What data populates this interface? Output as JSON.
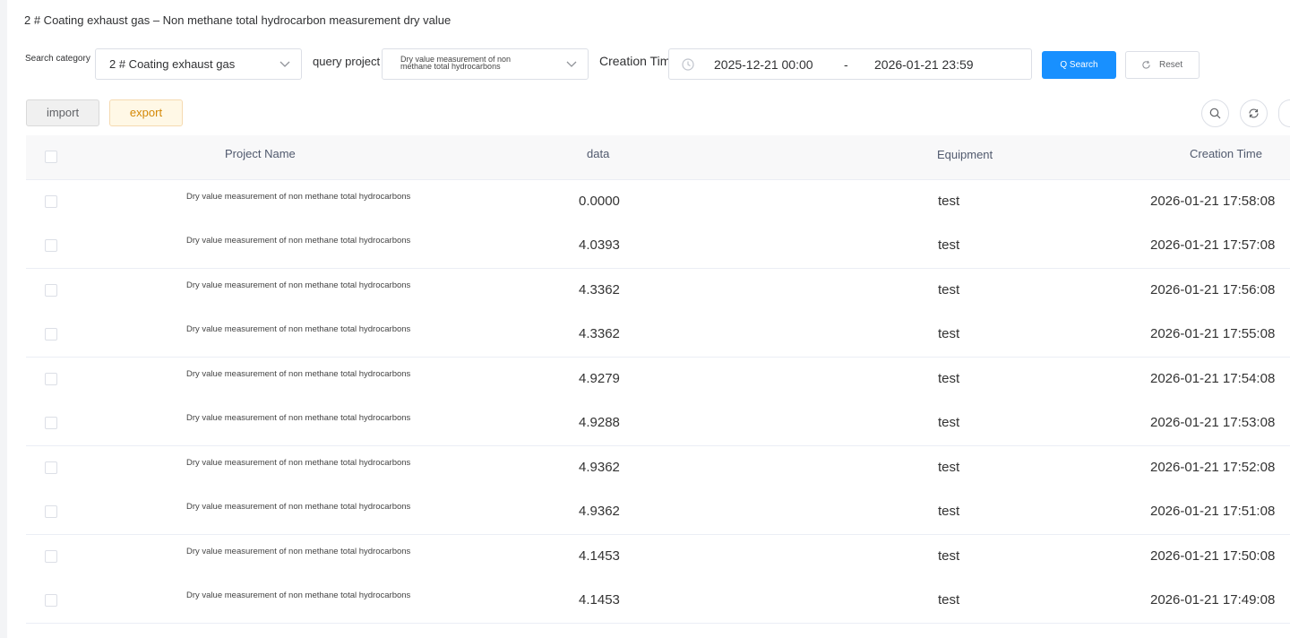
{
  "page": {
    "title": "2 # Coating exhaust gas – Non methane total hydrocarbon measurement dry value"
  },
  "filters": {
    "category_label": "Search category",
    "category_value": "2 # Coating exhaust gas",
    "project_label": "query project",
    "project_value": "Dry value measurement of non methane total hydrocarbons",
    "time_label": "Creation Time",
    "start": "2025-12-21 00:00",
    "separator": "-",
    "end": "2026-01-21 23:59",
    "search_label": "Q Search",
    "reset_label": "Reset"
  },
  "toolbar": {
    "import_label": "import",
    "export_label": "export"
  },
  "colors": {
    "primary": "#1890ff",
    "export_bg": "#fff8e6",
    "export_text": "#d48806"
  },
  "table": {
    "columns": {
      "name": "Project Name",
      "data": "data",
      "equipment": "Equipment",
      "time": "Creation Time"
    },
    "rows": [
      {
        "name": "Dry value measurement of non methane total hydrocarbons",
        "data": "0.0000",
        "equipment": "test",
        "time": "2026-01-21 17:58:08"
      },
      {
        "name": "Dry value measurement of non methane total hydrocarbons",
        "data": "4.0393",
        "equipment": "test",
        "time": "2026-01-21 17:57:08"
      },
      {
        "name": "Dry value measurement of non methane total hydrocarbons",
        "data": "4.3362",
        "equipment": "test",
        "time": "2026-01-21 17:56:08"
      },
      {
        "name": "Dry value measurement of non methane total hydrocarbons",
        "data": "4.3362",
        "equipment": "test",
        "time": "2026-01-21 17:55:08"
      },
      {
        "name": "Dry value measurement of non methane total hydrocarbons",
        "data": "4.9279",
        "equipment": "test",
        "time": "2026-01-21 17:54:08"
      },
      {
        "name": "Dry value measurement of non methane total hydrocarbons",
        "data": "4.9288",
        "equipment": "test",
        "time": "2026-01-21 17:53:08"
      },
      {
        "name": "Dry value measurement of non methane total hydrocarbons",
        "data": "4.9362",
        "equipment": "test",
        "time": "2026-01-21 17:52:08"
      },
      {
        "name": "Dry value measurement of non methane total hydrocarbons",
        "data": "4.9362",
        "equipment": "test",
        "time": "2026-01-21 17:51:08"
      },
      {
        "name": "Dry value measurement of non methane total hydrocarbons",
        "data": "4.1453",
        "equipment": "test",
        "time": "2026-01-21 17:50:08"
      },
      {
        "name": "Dry value measurement of non methane total hydrocarbons",
        "data": "4.1453",
        "equipment": "test",
        "time": "2026-01-21 17:49:08"
      }
    ]
  }
}
